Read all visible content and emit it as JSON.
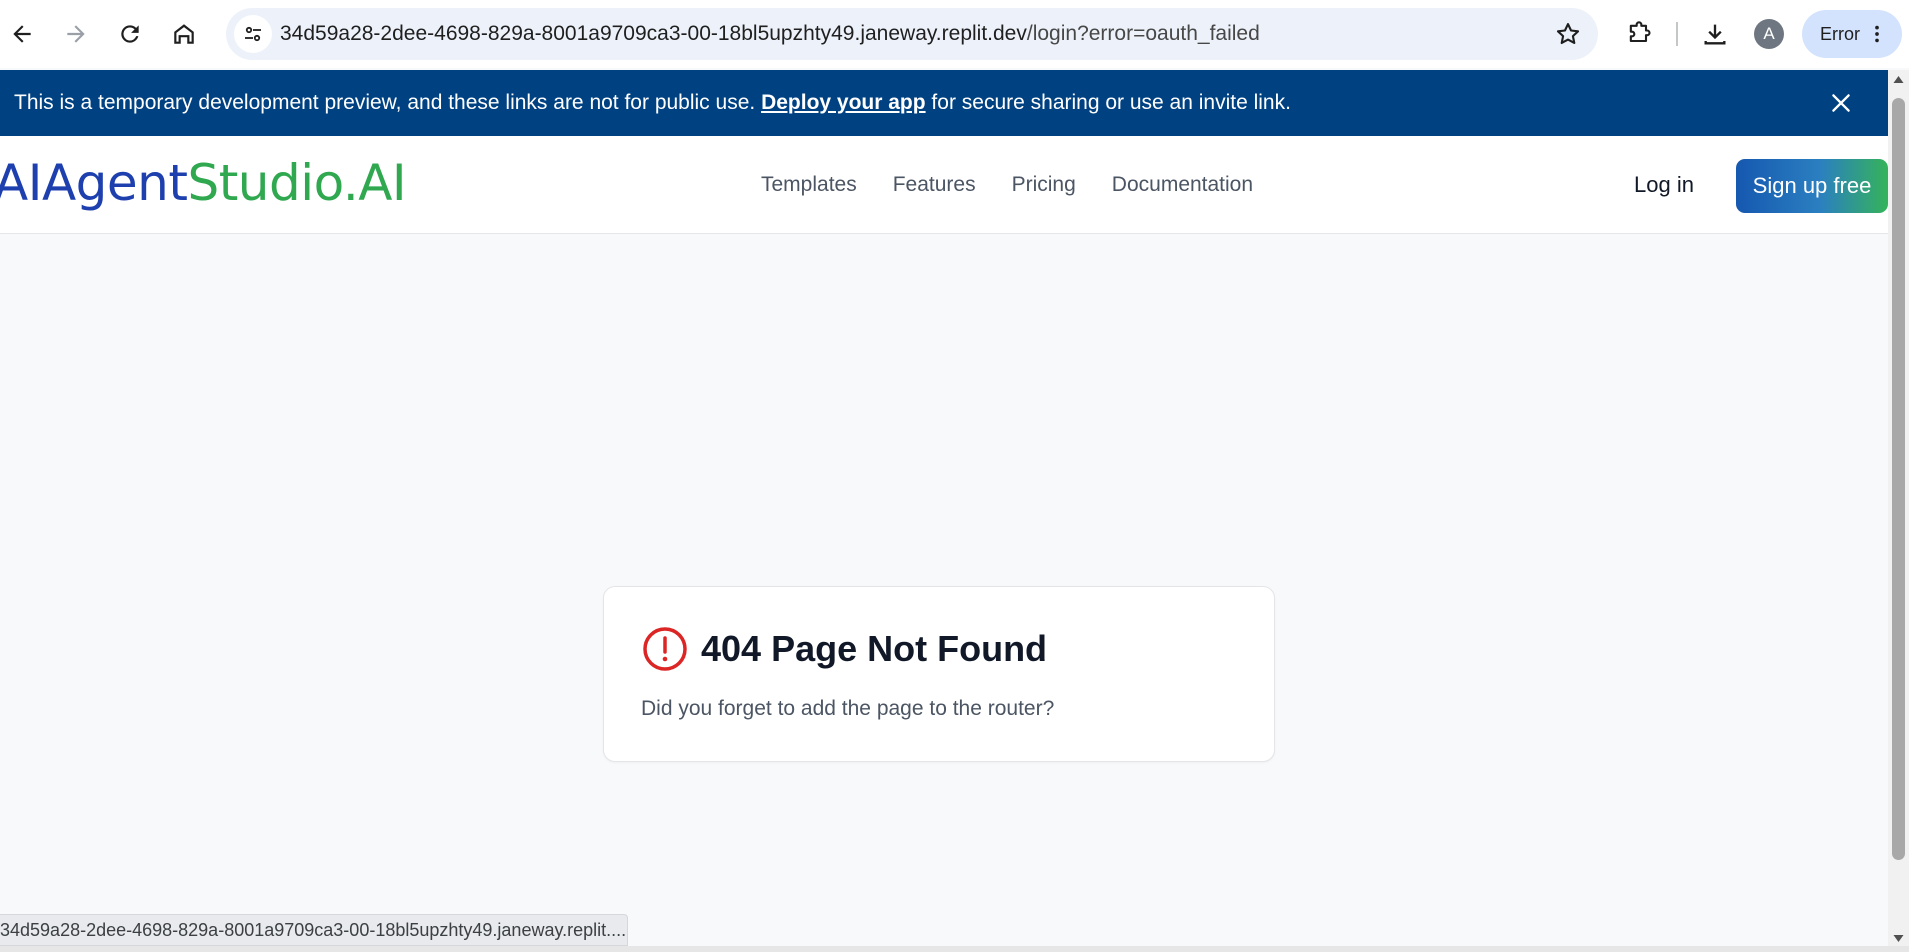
{
  "browser": {
    "url_host": "34d59a28-2dee-4698-829a-8001a9709ca3-00-18bl5upzhty49.janeway.replit.dev",
    "url_path": "/login?error=oauth_failed",
    "profile_initial": "A",
    "error_chip_label": "Error",
    "status_url": "34d59a28-2dee-4698-829a-8001a9709ca3-00-18bl5upzhty49.janeway.replit...."
  },
  "banner": {
    "text_before": "This is a temporary development preview, and these links are not for public use. ",
    "link_text": "Deploy your app",
    "text_after": " for secure sharing or use an invite link."
  },
  "header": {
    "logo_part1": "AIAgent",
    "logo_part2": "Studio.AI",
    "nav": [
      "Templates",
      "Features",
      "Pricing",
      "Documentation"
    ],
    "login_label": "Log in",
    "signup_label": "Sign up free"
  },
  "main": {
    "title": "404 Page Not Found",
    "description": "Did you forget to add the page to the router?"
  },
  "colors": {
    "banner_bg": "#004182",
    "logo_blue": "#1e40af",
    "logo_green": "#2fa84f",
    "alert_red": "#dc2626"
  },
  "icons": [
    "back-icon",
    "forward-icon",
    "reload-icon",
    "home-icon",
    "site-info-icon",
    "star-icon",
    "extensions-icon",
    "download-icon",
    "more-vert-icon",
    "close-icon",
    "alert-circle-icon"
  ]
}
